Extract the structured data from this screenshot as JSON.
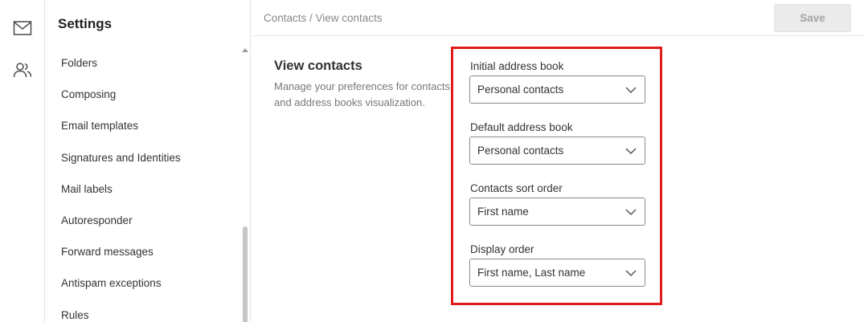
{
  "rail": {
    "items": [
      {
        "icon": "mail-icon"
      },
      {
        "icon": "contacts-icon"
      }
    ]
  },
  "sidebar": {
    "title": "Settings",
    "items": [
      {
        "label": "Folders"
      },
      {
        "label": "Composing"
      },
      {
        "label": "Email templates"
      },
      {
        "label": "Signatures and Identities"
      },
      {
        "label": "Mail labels"
      },
      {
        "label": "Autoresponder"
      },
      {
        "label": "Forward messages"
      },
      {
        "label": "Antispam exceptions"
      },
      {
        "label": "Rules"
      }
    ]
  },
  "header": {
    "breadcrumb": "Contacts / View contacts",
    "save_label": "Save"
  },
  "section": {
    "title": "View contacts",
    "description": "Manage your preferences for contacts and address books visualization."
  },
  "fields": [
    {
      "label": "Initial address book",
      "value": "Personal contacts"
    },
    {
      "label": "Default address book",
      "value": "Personal contacts"
    },
    {
      "label": "Contacts sort order",
      "value": "First name"
    },
    {
      "label": "Display order",
      "value": "First name, Last name"
    }
  ],
  "colors": {
    "highlight": "#e01b1b",
    "save_disabled_bg": "#ebebeb"
  }
}
